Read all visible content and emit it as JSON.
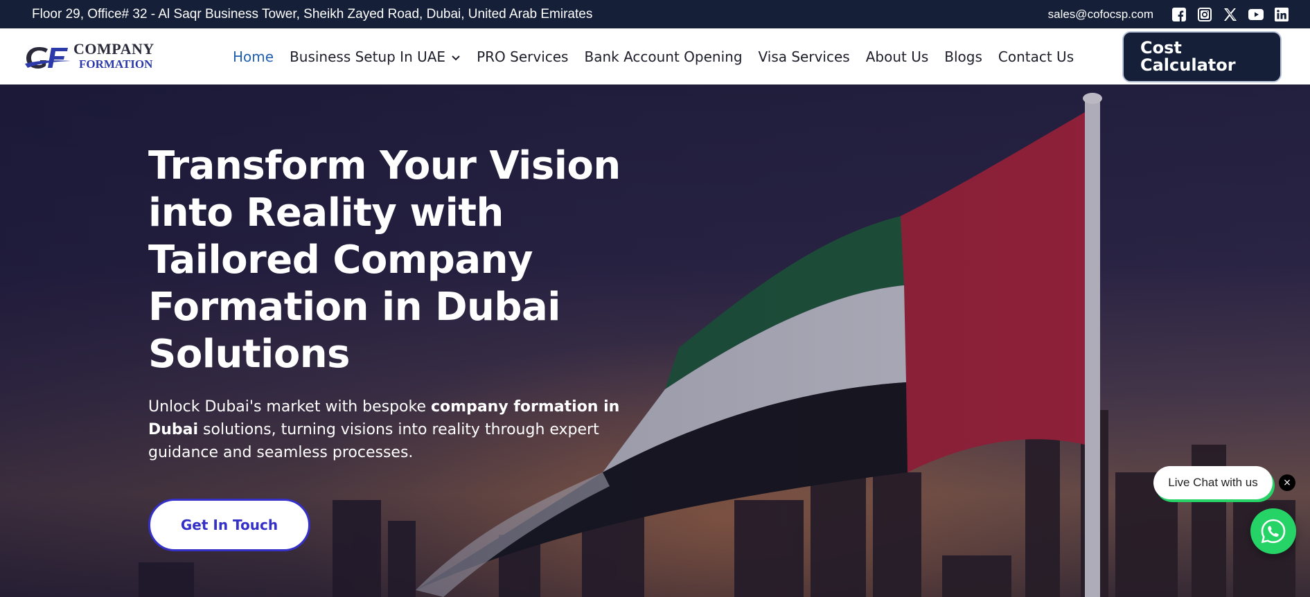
{
  "topbar": {
    "address": "Floor 29, Office# 32 - Al Saqr Business Tower, Sheikh Zayed Road, Dubai, United Arab Emirates",
    "email": "sales@cofocsp.com",
    "social": [
      "facebook-icon",
      "instagram-icon",
      "x-icon",
      "youtube-icon",
      "linkedin-icon"
    ]
  },
  "logo": {
    "line1": "COMPANY",
    "line2": "FORMATION"
  },
  "nav": {
    "items": [
      {
        "label": "Home",
        "active": true
      },
      {
        "label": "Business Setup In UAE",
        "dropdown": true
      },
      {
        "label": "PRO Services"
      },
      {
        "label": "Bank Account Opening"
      },
      {
        "label": "Visa Services"
      },
      {
        "label": "About Us"
      },
      {
        "label": "Blogs"
      },
      {
        "label": "Contact Us"
      }
    ],
    "active_color": "#1f5fb0"
  },
  "cost_button": {
    "label": "Cost Calculator"
  },
  "hero": {
    "title": "Transform Your Vision into Reality with Tailored Company Formation in Dubai Solutions",
    "desc_part1": "Unlock Dubai's market with bespoke ",
    "desc_bold": "company formation in Dubai",
    "desc_part2": " solutions, turning visions into reality through expert guidance and seamless processes.",
    "cta": "Get In Touch"
  },
  "chat": {
    "label": "Live Chat with us",
    "close": "×"
  },
  "colors": {
    "topbar": "#152038",
    "cta_border": "#3430c8",
    "whatsapp": "#25d366"
  }
}
